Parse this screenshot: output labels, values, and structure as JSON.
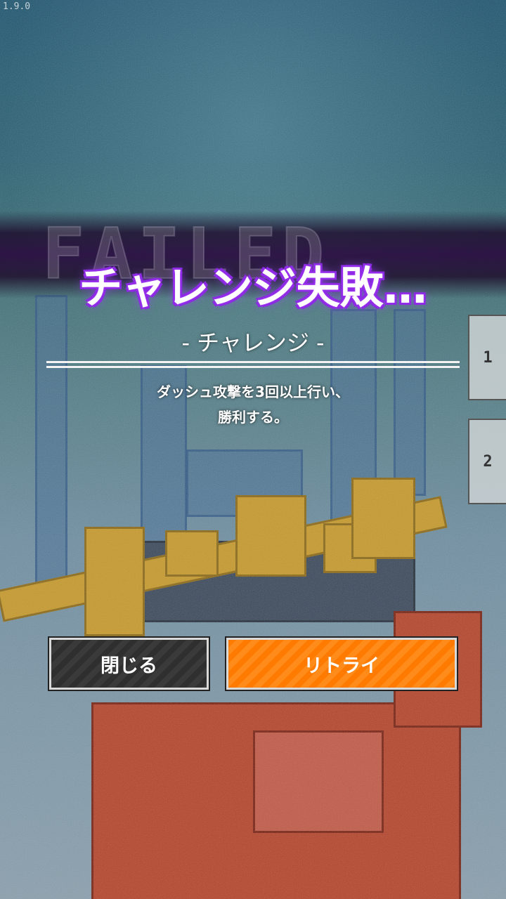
{
  "hud": {
    "version": "1.9.0",
    "side_tabs": [
      "1",
      "2"
    ]
  },
  "result": {
    "background_word": "FAILED",
    "title": "チャレンジ失敗…",
    "challenge_label": "- チャレンジ -",
    "description_line1": "ダッシュ攻撃を3回以上行い、",
    "description_line2": "勝利する。"
  },
  "buttons": {
    "close_label": "閉じる",
    "retry_label": "リトライ"
  },
  "colors": {
    "title_glow": "#8a2be2",
    "retry_button": "#ff7a00",
    "close_button": "#2f2f2f"
  }
}
